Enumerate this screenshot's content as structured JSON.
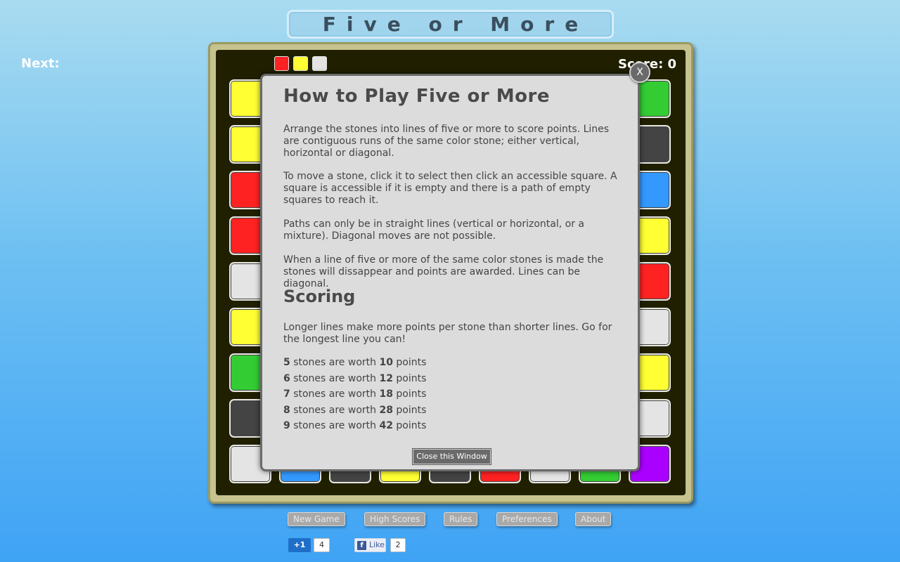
{
  "colors": {
    "yellow": "#ffff33",
    "red": "#ff2222",
    "white": "#e4e4e4",
    "green": "#33cc33",
    "dark": "#444444",
    "blue": "#3399ff",
    "purple": "#aa00ff"
  },
  "header": {
    "title": "Five or More"
  },
  "status": {
    "next_label": "Next:",
    "score_label": "Score: 0",
    "next_stones": [
      "red",
      "yellow",
      "white"
    ]
  },
  "board": {
    "left_column": [
      "yellow",
      "yellow",
      "red",
      "red",
      "white",
      "yellow",
      "green",
      "dark",
      "white"
    ],
    "right_column": [
      "green",
      "dark",
      "blue",
      "yellow",
      "red",
      "white",
      "yellow",
      "white",
      "purple"
    ],
    "bottom_row_visible": [
      "blue",
      "dark",
      "yellow",
      "dark",
      "red",
      "white",
      "green"
    ]
  },
  "dialog": {
    "close_x": "X",
    "heading": "How to Play Five or More",
    "paragraphs": [
      "Arrange the stones into lines of five or more to score points. Lines are contiguous runs of the same color stone; either vertical, horizontal or diagonal.",
      "To move a stone, click it to select then click an accessible square. A square is accessible if it is empty and there is a path of empty squares to reach it.",
      "Paths can only be in straight lines (vertical or horizontal, or a mixture). Diagonal moves are not possible.",
      "When a line of five or more of the same color stones is made the stones will dissappear and points are awarded. Lines can be diagonal."
    ],
    "scoring_heading": "Scoring",
    "scoring_text": "Longer lines make more points per stone than shorter lines. Go for the longest line you can!",
    "points": [
      {
        "stones": "5",
        "mid": "stones are worth",
        "worth": "10",
        "unit": "points"
      },
      {
        "stones": "6",
        "mid": "stones are worth",
        "worth": "12",
        "unit": "points"
      },
      {
        "stones": "7",
        "mid": "stones are worth",
        "worth": "18",
        "unit": "points"
      },
      {
        "stones": "8",
        "mid": "stones are worth",
        "worth": "28",
        "unit": "points"
      },
      {
        "stones": "9",
        "mid": "stones are worth",
        "worth": "42",
        "unit": "points"
      }
    ],
    "close_button": "Close this Window"
  },
  "menu": {
    "new_game": "New Game",
    "high_scores": "High Scores",
    "rules": "Rules",
    "preferences": "Preferences",
    "about": "About"
  },
  "social": {
    "gplus_label": "+1",
    "gplus_count": "4",
    "fb_label": "Like",
    "fb_icon": "f",
    "fb_count": "2"
  }
}
